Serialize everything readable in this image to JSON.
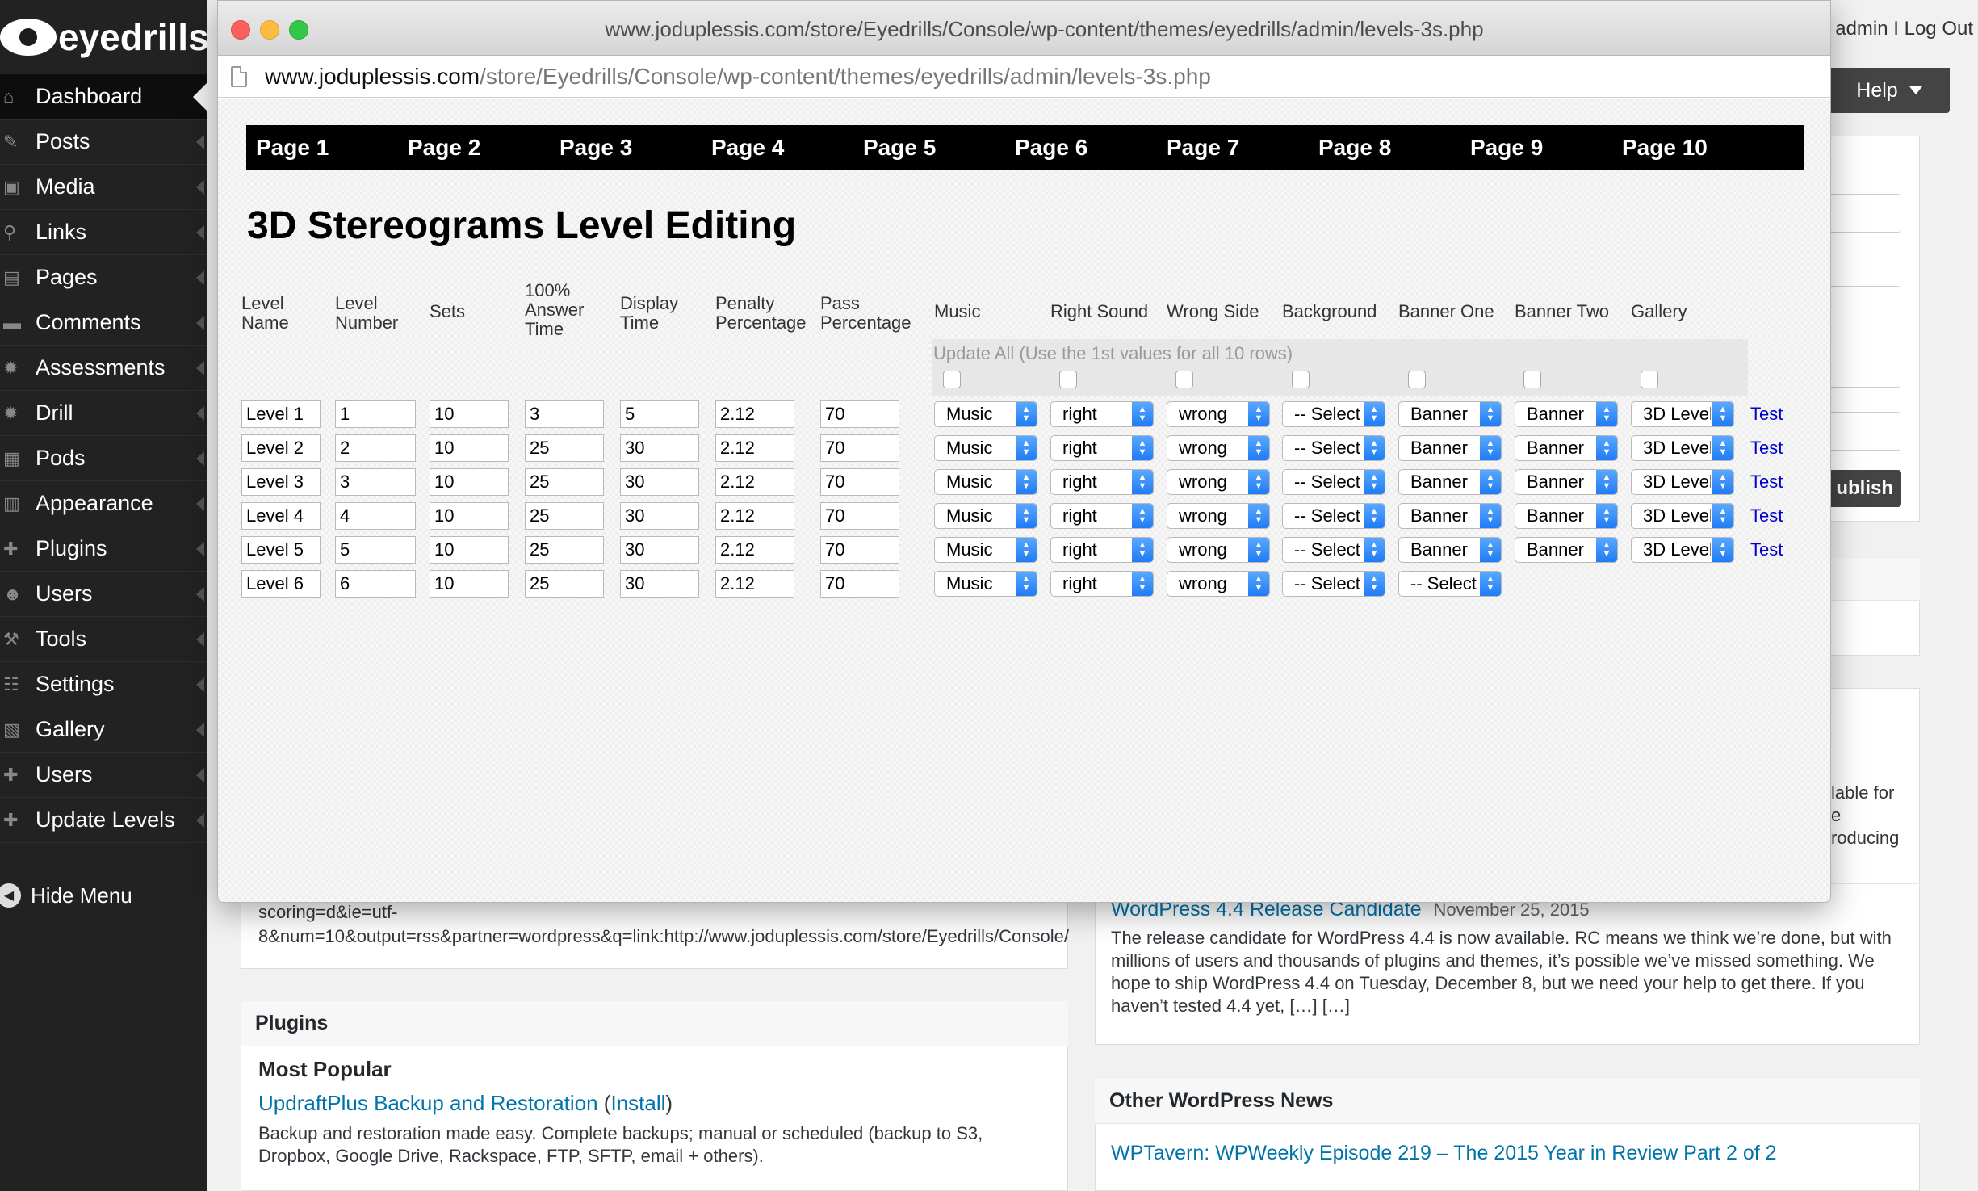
{
  "admin": {
    "brand": "eyedrills",
    "user_links": "admin I Log Out",
    "help_tab": "Help",
    "sidebar": [
      {
        "label": "Dashboard",
        "icon": "home-icon",
        "glyph": "⌂",
        "active": true
      },
      {
        "label": "Posts",
        "icon": "pin-icon",
        "glyph": "✎"
      },
      {
        "label": "Media",
        "icon": "media-icon",
        "glyph": "▣"
      },
      {
        "label": "Links",
        "icon": "link-icon",
        "glyph": "⚲"
      },
      {
        "label": "Pages",
        "icon": "pages-icon",
        "glyph": "▤"
      },
      {
        "label": "Comments",
        "icon": "comment-icon",
        "glyph": "▬"
      },
      {
        "label": "Assessments",
        "icon": "gear-icon",
        "glyph": "✹"
      },
      {
        "label": "Drill",
        "icon": "gear-icon",
        "glyph": "✹"
      },
      {
        "label": "Pods",
        "icon": "pods-icon",
        "glyph": "▦"
      },
      {
        "label": "Appearance",
        "icon": "appearance-icon",
        "glyph": "▥"
      },
      {
        "label": "Plugins",
        "icon": "plugin-icon",
        "glyph": "✚"
      },
      {
        "label": "Users",
        "icon": "users-icon",
        "glyph": "☻"
      },
      {
        "label": "Tools",
        "icon": "tools-icon",
        "glyph": "⚒"
      },
      {
        "label": "Settings",
        "icon": "settings-icon",
        "glyph": "☷"
      },
      {
        "label": "Gallery",
        "icon": "gallery-icon",
        "glyph": "▧"
      },
      {
        "label": "Users",
        "icon": "plugin-icon",
        "glyph": "✚"
      },
      {
        "label": "Update Levels",
        "icon": "plugin-icon",
        "glyph": "✚"
      }
    ],
    "hide_menu": "Hide Menu",
    "publish_label": "ublish",
    "widgets": {
      "right_text_1": "lable for",
      "right_text_2": "e",
      "right_text_3": "roducing",
      "scoring_line1": "scoring=d&ie=utf-",
      "scoring_line2": "8&num=10&output=rss&partner=wordpress&q=link:http://www.joduplessis.com/store/Eyedrills/Console/",
      "news_title": "WordPress 4.4 Release Candidate",
      "news_date": "November 25, 2015",
      "news_body": "The release candidate for WordPress 4.4 is now available. RC means we think we’re done, but with millions of users and thousands of plugins and themes, it’s possible we’ve missed something. We hope to ship WordPress 4.4 on Tuesday, December 8, but we need your help to get there. If you haven’t tested 4.4 yet, […] […]",
      "plugins_head": "Plugins",
      "most_popular": "Most Popular",
      "plugin_name": "UpdraftPlus Backup and Restoration",
      "install_open": " (",
      "install_label": "Install",
      "install_close": ")",
      "plugin_desc": "Backup and restoration made easy. Complete backups; manual or scheduled (backup to S3, Dropbox, Google Drive, Rackspace, FTP, SFTP, email + others).",
      "other_news_head": "Other WordPress News",
      "other_news_link": "WPTavern: WPWeekly Episode 219 – The 2015 Year in Review Part 2 of 2"
    }
  },
  "window": {
    "title": "www.joduplessis.com/store/Eyedrills/Console/wp-content/themes/eyedrills/admin/levels-3s.php",
    "url_host": "www.joduplessis.com",
    "url_path": "/store/Eyedrills/Console/wp-content/themes/eyedrills/admin/levels-3s.php"
  },
  "page": {
    "tabs": [
      "Page 1",
      "Page 2",
      "Page 3",
      "Page 4",
      "Page 5",
      "Page 6",
      "Page 7",
      "Page 8",
      "Page 9",
      "Page 10"
    ],
    "title": "3D Stereograms Level Editing",
    "columns": [
      "Level Name",
      "Level Number",
      "Sets",
      "100% Answer Time",
      "Display Time",
      "Penalty Percentage",
      "Pass Percentage",
      "Music",
      "Right Sound",
      "Wrong Side",
      "Background",
      "Banner One",
      "Banner Two",
      "Gallery"
    ],
    "update_all": "Update All (Use the 1st values for all 10 rows)",
    "rows": [
      {
        "name": "Level 1",
        "number": "1",
        "sets": "10",
        "answer_time": "3",
        "display_time": "5",
        "penalty": "2.12",
        "pass": "70",
        "music": "Music",
        "right": "right",
        "wrong": "wrong",
        "background": "-- Select --",
        "banner_one": "Banner",
        "banner_two": "Banner",
        "gallery": "3D Level",
        "test": "Test"
      },
      {
        "name": "Level 2",
        "number": "2",
        "sets": "10",
        "answer_time": "25",
        "display_time": "30",
        "penalty": "2.12",
        "pass": "70",
        "music": "Music",
        "right": "right",
        "wrong": "wrong",
        "background": "-- Select --",
        "banner_one": "Banner",
        "banner_two": "Banner",
        "gallery": "3D Level",
        "test": "Test"
      },
      {
        "name": "Level 3",
        "number": "3",
        "sets": "10",
        "answer_time": "25",
        "display_time": "30",
        "penalty": "2.12",
        "pass": "70",
        "music": "Music",
        "right": "right",
        "wrong": "wrong",
        "background": "-- Select --",
        "banner_one": "Banner",
        "banner_two": "Banner",
        "gallery": "3D Level",
        "test": "Test"
      },
      {
        "name": "Level 4",
        "number": "4",
        "sets": "10",
        "answer_time": "25",
        "display_time": "30",
        "penalty": "2.12",
        "pass": "70",
        "music": "Music",
        "right": "right",
        "wrong": "wrong",
        "background": "-- Select --",
        "banner_one": "Banner",
        "banner_two": "Banner",
        "gallery": "3D Level",
        "test": "Test"
      },
      {
        "name": "Level 5",
        "number": "5",
        "sets": "10",
        "answer_time": "25",
        "display_time": "30",
        "penalty": "2.12",
        "pass": "70",
        "music": "Music",
        "right": "right",
        "wrong": "wrong",
        "background": "-- Select --",
        "banner_one": "Banner",
        "banner_two": "Banner",
        "gallery": "3D Level",
        "test": "Test"
      },
      {
        "name": "Level 6",
        "number": "6",
        "sets": "10",
        "answer_time": "25",
        "display_time": "30",
        "penalty": "2.12",
        "pass": "70",
        "music": "Music",
        "right": "right",
        "wrong": "wrong",
        "background": "-- Select --",
        "banner_one": "-- Select --",
        "banner_two": "",
        "gallery": "",
        "test": ""
      }
    ]
  },
  "colors": {
    "sidebar": "#222222",
    "nav_bar": "#000000",
    "link_blue": "#0073aa",
    "test_link": "#0000cc",
    "select_button": "#1f7cf5"
  }
}
